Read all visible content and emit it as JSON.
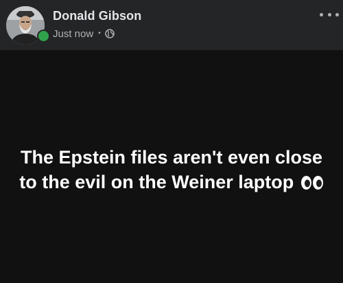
{
  "post": {
    "author": "Donald Gibson",
    "timestamp": "Just now",
    "separator": "•",
    "audience_icon": "globe-icon",
    "text_line1": "The Epstein files aren't even close",
    "text_line2": "to the evil on the Weiner laptop",
    "emoji": "eyes-icon",
    "status": "online",
    "colors": {
      "header_bg": "#242526",
      "post_bg": "#111111",
      "online": "#31a24c",
      "text": "#ffffff",
      "muted": "#b0b3b8"
    }
  }
}
